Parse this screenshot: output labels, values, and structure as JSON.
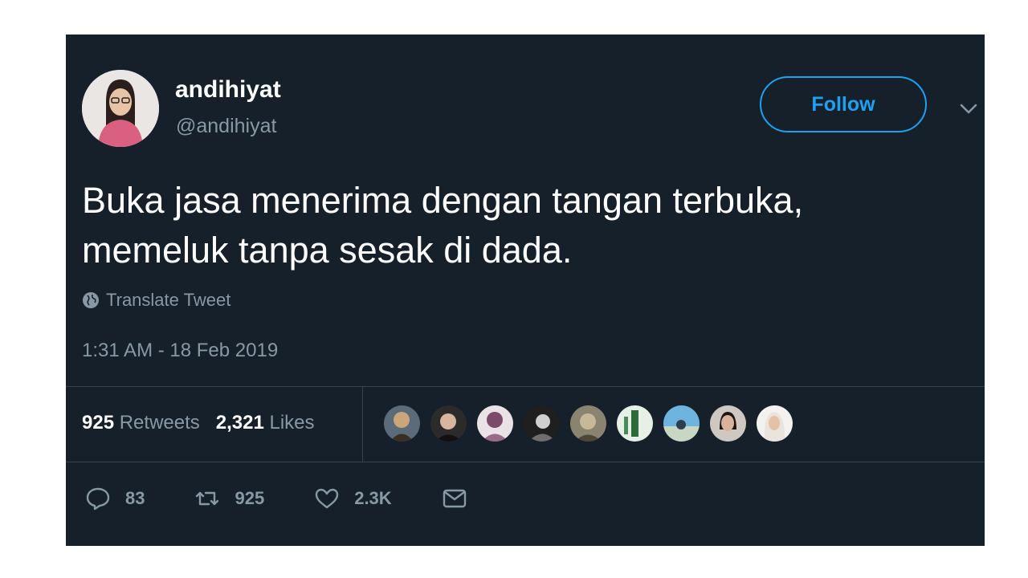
{
  "user": {
    "display_name": "andihiyat",
    "handle": "@andihiyat"
  },
  "follow_label": "Follow",
  "tweet": {
    "line1": "Buka jasa menerima dengan tangan terbuka,",
    "line2": "memeluk tanpa sesak di dada.",
    "translate_label": "Translate Tweet",
    "timestamp": "1:31 AM - 18 Feb 2019"
  },
  "stats": {
    "retweets_count": "925",
    "retweets_label": "Retweets",
    "likes_count": "2,321",
    "likes_label": "Likes"
  },
  "actions": {
    "replies": "83",
    "retweets": "925",
    "likes": "2.3K"
  },
  "colors": {
    "background": "#15202b",
    "accent": "#1da1f2",
    "secondary_text": "#8899a6",
    "divider": "#38444d"
  },
  "icons": [
    "globe-icon",
    "chevron-down-icon",
    "reply-icon",
    "retweet-icon",
    "heart-icon",
    "message-icon"
  ]
}
